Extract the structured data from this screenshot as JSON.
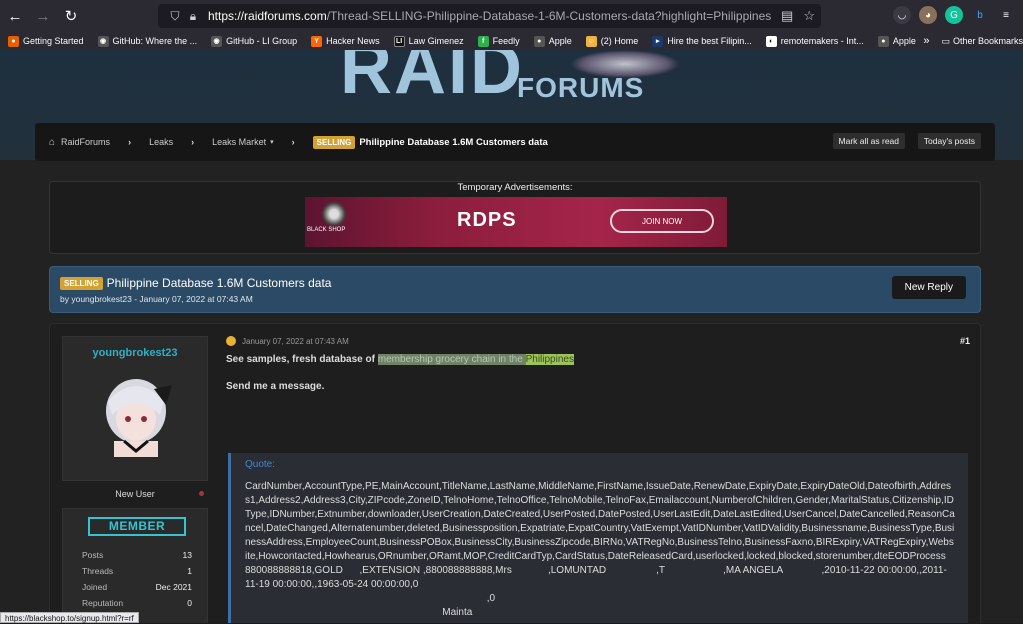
{
  "browser": {
    "url_host": "https://raidforums.com",
    "url_path": "/Thread-SELLING-Philippine-Database-1-6M-Customers-data?highlight=Philippines",
    "bookmarks": [
      {
        "label": "Getting Started",
        "color": "#e66000",
        "glyph": "●"
      },
      {
        "label": "GitHub: Where the ...",
        "color": "#555",
        "glyph": "◉"
      },
      {
        "label": "GitHub - LI Group",
        "color": "#555",
        "glyph": "◉"
      },
      {
        "label": "Hacker News",
        "color": "#ff6600",
        "glyph": "Y"
      },
      {
        "label": "Law Gimenez",
        "color": "#222",
        "glyph": "LI"
      },
      {
        "label": "Feedly",
        "color": "#2bb24c",
        "glyph": "f"
      },
      {
        "label": "Apple",
        "color": "#555",
        "glyph": ""
      },
      {
        "label": "(2) Home",
        "color": "#f2b33d",
        "glyph": "☺"
      },
      {
        "label": "Hire the best Filipin...",
        "color": "#1b3a6b",
        "glyph": "▸"
      },
      {
        "label": "remotemakers - Int...",
        "color": "#111",
        "glyph": "◐"
      },
      {
        "label": "Apple Developer Fo...",
        "color": "#555",
        "glyph": ""
      }
    ],
    "other_bookmarks": "Other Bookmarks",
    "status_url": "https://blackshop.to/signup.html?r=rf"
  },
  "site": {
    "logo_big": "RAID",
    "logo_small": "FORUMS"
  },
  "breadcrumb": {
    "home": "RaidForums",
    "items": [
      "Leaks",
      "Leaks Market"
    ],
    "badge": "SELLING",
    "title": "Philippine Database 1.6M Customers data",
    "mark_read": "Mark all as read",
    "todays_posts": "Today's posts"
  },
  "ad": {
    "label": "Temporary Advertisements:",
    "brand": "RDPS",
    "join": "JOIN NOW",
    "shop": "BLACK SHOP"
  },
  "thread": {
    "badge": "SELLING",
    "title": "Philippine Database 1.6M Customers data",
    "byline": "by youngbrokest23 - January 07, 2022 at 07:43 AM",
    "new_reply": "New Reply"
  },
  "author": {
    "name": "youngbrokest23",
    "usertitle": "New User",
    "rank": "MEMBER",
    "stats": [
      {
        "label": "Posts",
        "value": "13"
      },
      {
        "label": "Threads",
        "value": "1"
      },
      {
        "label": "Joined",
        "value": "Dec 2021"
      },
      {
        "label": "Reputation",
        "value": "0"
      }
    ]
  },
  "post": {
    "date": "January 07, 2022 at 07:43 AM",
    "number": "#1",
    "line1_prefix": "See samples, fresh database of ",
    "line1_highlight": "membership grocery chain in the ",
    "line1_highlight2": "Philippines",
    "line2": "Send me a message.",
    "quote_label": "Quote:",
    "quote_text": "CardNumber,AccountType,PE,MainAccount,TitleName,LastName,MiddleName,FirstName,IssueDate,RenewDate,ExpiryDate,ExpiryDateOld,Dateofbirth,Address1,Address2,Address3,City,ZIPcode,ZoneID,TelnoHome,TelnoOffice,TelnoMobile,TelnoFax,Emailaccount,NumberofChildren,Gender,MaritalStatus,Citizenship,IDType,IDNumber,Extnumber,downloader,UserCreation,DateCreated,UserPosted,DatePosted,UserLastEdit,DateLastEdited,UserCancel,DateCancelled,ReasonCancel,DateChanged,Alternatenumber,deleted,Businessposition,Expatriate,ExpatCountry,VatExempt,VatIDNumber,VatIDValidity,Businessname,BusinessType,BusinessAddress,EmployeeCount,BusinessPOBox,BusinessCity,BusinessZipcode,BIRNo,VATRegNo,BusinessTelno,BusinessFaxno,BIRExpiry,VATRegExpiry,Website,Howcontacted,Howhearus,ORnumber,ORamt,MOP,CreditCardTyp,CardStatus,DateReleasedCard,userlocked,locked,blocked,storenumber,dteEODProcess\n880088888818,GOLD      ,EXTENSION ,880088888888,Mrs             ,LOMUNTAD                  ,T                     ,MA ANGELA              ,2010-11-22 00:00:00,,2011-11-19 00:00:00,,1963-05-24 00:00:00,0\n                                                                                       ,0\n                                                                       Mainta"
  }
}
